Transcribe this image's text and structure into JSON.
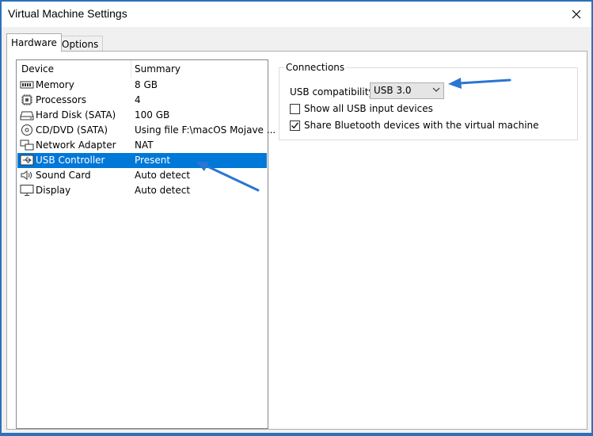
{
  "window": {
    "title": "Virtual Machine Settings"
  },
  "tabs": [
    {
      "label": "Hardware",
      "active": true
    },
    {
      "label": "Options",
      "active": false
    }
  ],
  "device_list": {
    "columns": [
      "Device",
      "Summary"
    ],
    "rows": [
      {
        "name": "Memory",
        "summary": "8 GB",
        "icon": "memory-icon"
      },
      {
        "name": "Processors",
        "summary": "4",
        "icon": "processor-icon"
      },
      {
        "name": "Hard Disk (SATA)",
        "summary": "100 GB",
        "icon": "hard-disk-icon"
      },
      {
        "name": "CD/DVD (SATA)",
        "summary": "Using file F:\\macOS Mojave ...",
        "icon": "cd-dvd-icon"
      },
      {
        "name": "Network Adapter",
        "summary": "NAT",
        "icon": "network-adapter-icon"
      },
      {
        "name": "USB Controller",
        "summary": "Present",
        "icon": "usb-icon",
        "selected": true
      },
      {
        "name": "Sound Card",
        "summary": "Auto detect",
        "icon": "sound-icon"
      },
      {
        "name": "Display",
        "summary": "Auto detect",
        "icon": "display-icon"
      }
    ]
  },
  "connections": {
    "title": "Connections",
    "compat_label": "USB compatibility:",
    "compat_value": "USB 3.0",
    "show_all_label": "Show all USB input devices",
    "show_all_checked": false,
    "share_bt_label": "Share Bluetooth devices with the virtual machine",
    "share_bt_checked": true
  },
  "colors": {
    "selection": "#0078d7",
    "annotation_arrow": "#2a76d2",
    "frame": "#2f6fb8"
  }
}
